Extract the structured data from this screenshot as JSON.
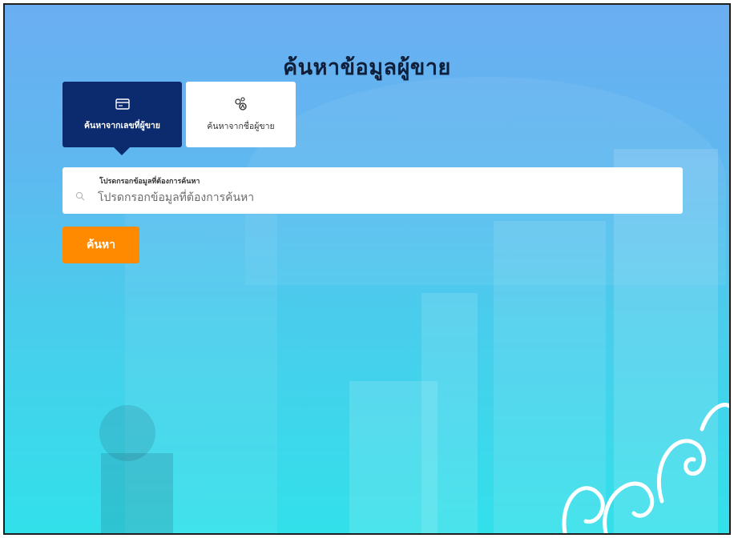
{
  "page": {
    "title": "ค้นหาข้อมูลผู้ขาย"
  },
  "tabs": [
    {
      "label": "ค้นหาจากเลขที่ผู้ขาย",
      "icon": "card-icon",
      "active": true
    },
    {
      "label": "ค้นหาจากชื่อผู้ขาย",
      "icon": "people-search-icon",
      "active": false
    }
  ],
  "search": {
    "label": "โปรดกรอกข้อมูลที่ต้องการค้นหา",
    "placeholder": "โปรดกรอกข้อมูลที่ต้องการค้นหา",
    "value": "",
    "icon": "search-icon"
  },
  "actions": {
    "search_label": "ค้นหา"
  },
  "colors": {
    "active_tab": "#0c2b6e",
    "primary_button": "#ff8a00",
    "background_top": "#6aaef2",
    "background_bottom": "#32e0ea"
  }
}
